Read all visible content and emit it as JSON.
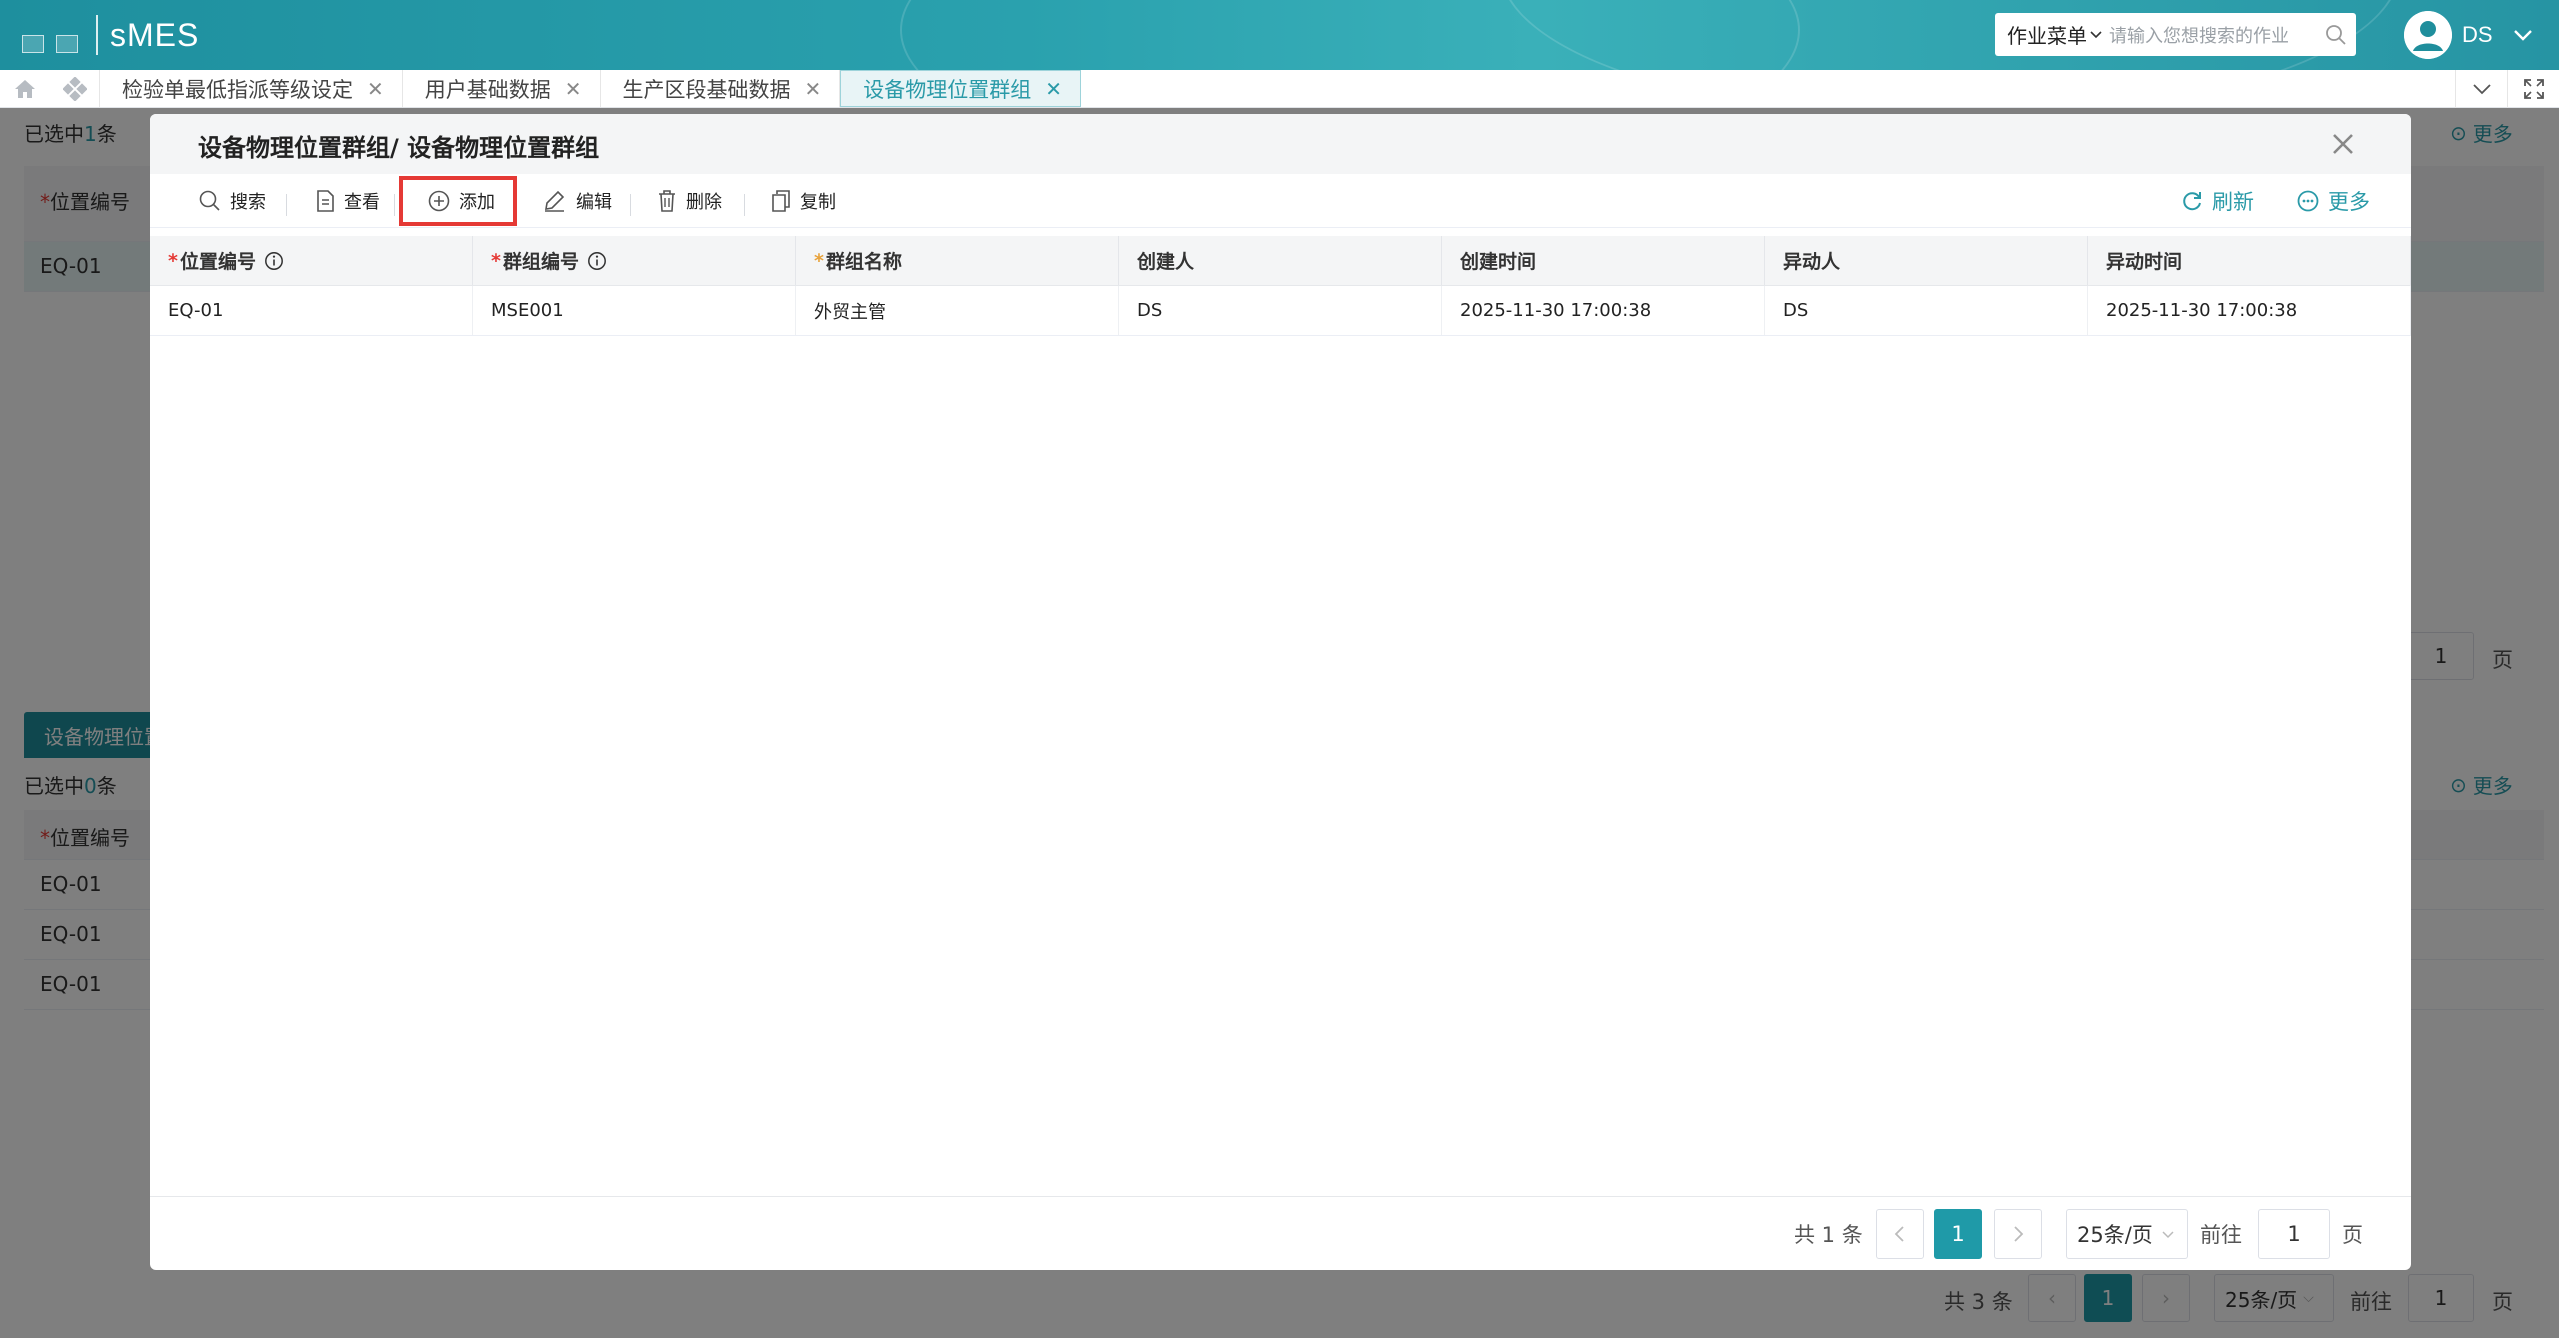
{
  "header": {
    "app_name": "sMES",
    "menu_select": "作业菜单",
    "search_placeholder": "请输入您想搜索的作业",
    "user": "DS"
  },
  "tabs": [
    {
      "label": "检验单最低指派等级设定",
      "active": false
    },
    {
      "label": "用户基础数据",
      "active": false
    },
    {
      "label": "生产区段基础数据",
      "active": false
    },
    {
      "label": "设备物理位置群组",
      "active": true
    }
  ],
  "background": {
    "selected_top": "已选中",
    "selected_top_count": "1",
    "selected_top_unit": "条",
    "col_position": "位置编号",
    "row_top": "EQ-01",
    "more": "更多",
    "page_input": "1",
    "page_unit": "页",
    "sub_tab": "设备物理位置群组",
    "selected_bottom": "已选中",
    "selected_bottom_count": "0",
    "selected_bottom_unit": "条",
    "rows_bottom": [
      "EQ-01",
      "EQ-01",
      "EQ-01"
    ],
    "footer_total": "共 3 条",
    "footer_page": "1",
    "footer_size": "25条/页",
    "footer_goto": "前往",
    "footer_goto_value": "1",
    "footer_goto_unit": "页"
  },
  "modal": {
    "title": "设备物理位置群组/ 设备物理位置群组",
    "toolbar": {
      "search": "搜索",
      "view": "查看",
      "add": "添加",
      "edit": "编辑",
      "delete": "删除",
      "copy": "复制",
      "refresh": "刷新",
      "more": "更多"
    },
    "columns": [
      {
        "label": "位置编号",
        "required": "red",
        "info": true
      },
      {
        "label": "群组编号",
        "required": "red",
        "info": true
      },
      {
        "label": "群组名称",
        "required": "orange",
        "info": false
      },
      {
        "label": "创建人",
        "required": "",
        "info": false
      },
      {
        "label": "创建时间",
        "required": "",
        "info": false
      },
      {
        "label": "异动人",
        "required": "",
        "info": false
      },
      {
        "label": "异动时间",
        "required": "",
        "info": false
      }
    ],
    "rows": [
      [
        "EQ-01",
        "MSE001",
        "外贸主管",
        "DS",
        "2025-11-30 17:00:38",
        "DS",
        "2025-11-30 17:00:38"
      ]
    ],
    "footer": {
      "total": "共 1 条",
      "page": "1",
      "size": "25条/页",
      "goto": "前往",
      "goto_value": "1",
      "goto_unit": "页"
    }
  },
  "colors": {
    "accent": "#1f9aa8",
    "highlight": "#e53935"
  }
}
